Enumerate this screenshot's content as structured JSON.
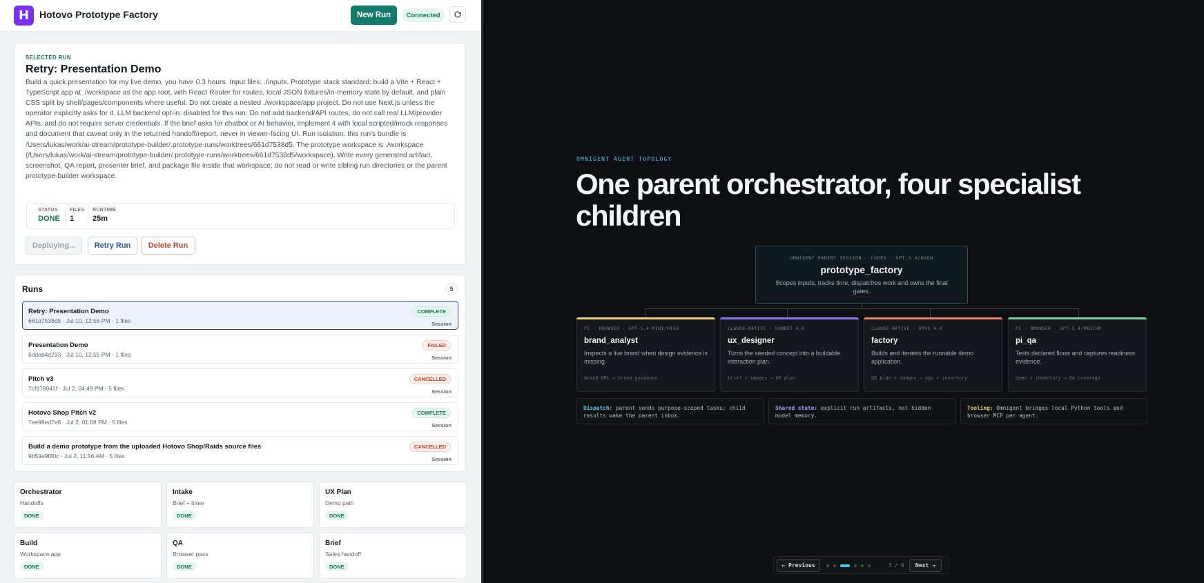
{
  "header": {
    "logo_letter": "H",
    "app_title": "Hotovo Prototype Factory",
    "new_run_label": "New Run",
    "connection_status": "Connected",
    "refresh_icon": "refresh-icon"
  },
  "selected_run": {
    "kicker": "SELECTED RUN",
    "title": "Retry: Presentation Demo",
    "description": "Build a quick presentation for my live demo, you have 0.3 hours. Input files: ./inputs. Prototype stack standard: build a Vite + React + TypeScript app at ./workspace as the app root, with React Router for routes, local JSON fixtures/in-memory state by default, and plain CSS split by shell/pages/components where useful. Do not create a nested ./workspace/app project. Do not use Next.js unless the operator explicitly asks for it. LLM backend opt-in: disabled for this run. Do not add backend/API routes, do not call real LLM/provider APIs, and do not require server credentials. If the brief asks for chatbot or AI behavior, implement it with local scripted/mock responses and document that caveat only in the returned handoff/report, never in viewer-facing UI. Run isolation: this run's bundle is /Users/lukas/work/ai-stream/prototype-builder/.prototype-runs/worktrees/661d7538d5. The prototype workspace is ./workspace (/Users/lukas/work/ai-stream/prototype-builder/.prototype-runs/worktrees/661d7538d5/workspace). Write every generated artifact, screenshot, QA report, presenter brief, and package file inside that workspace; do not read or write sibling run directories or the parent prototype-builder workspace.",
    "stats": [
      {
        "label": "STATUS",
        "value": "DONE"
      },
      {
        "label": "FILES",
        "value": "1"
      },
      {
        "label": "RUNTIME",
        "value": "25m"
      }
    ],
    "deploy_label": "Deploying...",
    "retry_label": "Retry Run",
    "delete_label": "Delete Run"
  },
  "runs": {
    "title": "Runs",
    "count": "5",
    "items": [
      {
        "name": "Retry: Presentation Demo",
        "meta": "661d7538d5 · Jul 10, 12:56 PM · 1 files",
        "status": "COMPLETE",
        "session": "Session"
      },
      {
        "name": "Presentation Demo",
        "meta": "6ddeb4d293 · Jul 10, 12:55 PM · 1 files",
        "status": "FAILED",
        "session": "Session"
      },
      {
        "name": "Pitch v3",
        "meta": "7cf978041f · Jul 2, 04:49 PM · 5 files",
        "status": "CANCELLED",
        "session": "Session"
      },
      {
        "name": "Hotovo Shop Pitch v2",
        "meta": "7ee98ed7e6 · Jul 2, 01:08 PM · 5 files",
        "status": "COMPLETE",
        "session": "Session"
      },
      {
        "name": "Build a demo prototype from the uploaded Hotovo Shop/Raids source files",
        "meta": "9b59e9f80c · Jul 2, 11:56 AM · 5 files",
        "status": "CANCELLED",
        "session": "Session"
      }
    ]
  },
  "stages": [
    {
      "name": "Orchestrator",
      "sub": "Handoffs",
      "status": "DONE"
    },
    {
      "name": "Intake",
      "sub": "Brief + timer",
      "status": "DONE"
    },
    {
      "name": "UX Plan",
      "sub": "Demo path",
      "status": "DONE"
    },
    {
      "name": "Build",
      "sub": "Workspace app",
      "status": "DONE"
    },
    {
      "name": "QA",
      "sub": "Browser pass",
      "status": "DONE"
    },
    {
      "name": "Brief",
      "sub": "Sales handoff",
      "status": "DONE"
    }
  ],
  "slide": {
    "kicker": "OMNIGENT AGENT TOPOLOGY",
    "headline": "One parent orchestrator, four specialist children",
    "parent": {
      "kicker": "OMNIGENT PARENT SESSION · CODEX · GPT-5.4/HIGH",
      "name": "prototype_factory",
      "desc": "Scopes inputs, tracks time, dispatches work and owns the final gates."
    },
    "children": [
      {
        "kicker": "PI · BROWSER · GPT-5.4-MINI/HIGH",
        "name": "brand_analyst",
        "desc": "Inspects a live brand when design evidence is missing.",
        "foot": "brand URL → brand guidance",
        "color": "#e8d27a"
      },
      {
        "kicker": "CLAUDE-NATIVE · SONNET 4.6",
        "name": "ux_designer",
        "desc": "Turns the seeded concept into a buildable interaction plan.",
        "foot": "brief + images → UX plan",
        "color": "#8f7af0"
      },
      {
        "kicker": "CLAUDE-NATIVE · OPUS 4.8",
        "name": "factory",
        "desc": "Builds and iterates the runnable demo application.",
        "foot": "UX plan + images → app + inventory",
        "color": "#e8876a"
      },
      {
        "kicker": "PI · BROWSER · GPT-5.4/MEDIUM",
        "name": "pi_qa",
        "desc": "Tests declared flows and captures readiness evidence.",
        "foot": "demo + inventory → QA coverage",
        "color": "#7ad3a8"
      }
    ],
    "info": [
      {
        "key": "Dispatch:",
        "text": " parent sends purpose-scoped tasks; child results wake the parent inbox.",
        "color": "#5fc6e8"
      },
      {
        "key": "Shared state:",
        "text": " explicit run artifacts, not hidden model memory.",
        "color": "#a99af5"
      },
      {
        "key": "Tooling:",
        "text": " Omnigent bridges local Python tools and browser MCP per agent.",
        "color": "#e8d27a"
      }
    ],
    "pager": {
      "prev_label": "← Previous",
      "next_label": "Next →",
      "page": "3 / 6",
      "total_pages": 6,
      "current_page": 3
    }
  }
}
